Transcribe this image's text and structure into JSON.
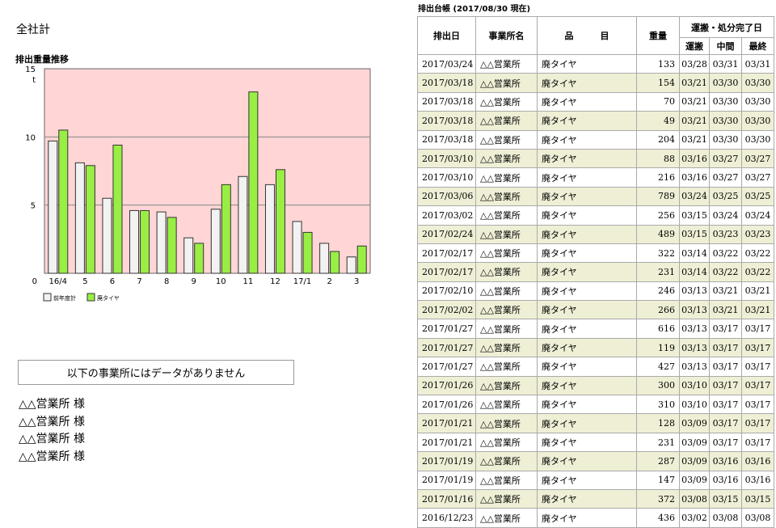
{
  "left": {
    "title": "全社計",
    "chart_title": "排出重量推移",
    "notice": "以下の事業所にはデータがありません",
    "offices": [
      "△△営業所 様",
      "△△営業所 様",
      "△△営業所 様",
      "△△営業所 様"
    ]
  },
  "chart_data": {
    "type": "bar",
    "title": "排出重量推移",
    "ylabel": "t",
    "ylim": [
      0,
      15
    ],
    "yticks": [
      0,
      5,
      10,
      15
    ],
    "categories": [
      "16/4",
      "5",
      "6",
      "7",
      "8",
      "9",
      "10",
      "11",
      "12",
      "17/1",
      "2",
      "3"
    ],
    "series": [
      {
        "name": "前年度計",
        "color": "#f2f2f2",
        "values": [
          9.7,
          8.1,
          5.5,
          4.6,
          4.5,
          2.6,
          4.7,
          7.1,
          6.5,
          3.8,
          2.2,
          1.2
        ]
      },
      {
        "name": "廃タイヤ",
        "color": "#99ee44",
        "values": [
          10.5,
          7.9,
          9.4,
          4.6,
          4.1,
          2.2,
          6.5,
          13.3,
          7.6,
          3.0,
          1.6,
          2.0
        ]
      }
    ],
    "plot_background": "#ffd5d5",
    "grid": true,
    "legend": "bottom-left"
  },
  "ledger": {
    "title": "排出台帳 (2017/08/30 現在)",
    "headers": {
      "date": "排出日",
      "office": "事業所名",
      "item": "品　　　目",
      "weight": "重量",
      "completion": "運搬・処分完了日",
      "transport": "運搬",
      "intermediate": "中間",
      "final": "最終"
    },
    "rows": [
      {
        "date": "2017/03/24",
        "office": "△△営業所",
        "item": "廃タイヤ",
        "weight": "133",
        "transport": "03/28",
        "intermediate": "03/31",
        "final": "03/31"
      },
      {
        "date": "2017/03/18",
        "office": "△△営業所",
        "item": "廃タイヤ",
        "weight": "154",
        "transport": "03/21",
        "intermediate": "03/30",
        "final": "03/30"
      },
      {
        "date": "2017/03/18",
        "office": "△△営業所",
        "item": "廃タイヤ",
        "weight": "70",
        "transport": "03/21",
        "intermediate": "03/30",
        "final": "03/30"
      },
      {
        "date": "2017/03/18",
        "office": "△△営業所",
        "item": "廃タイヤ",
        "weight": "49",
        "transport": "03/21",
        "intermediate": "03/30",
        "final": "03/30"
      },
      {
        "date": "2017/03/18",
        "office": "△△営業所",
        "item": "廃タイヤ",
        "weight": "204",
        "transport": "03/21",
        "intermediate": "03/30",
        "final": "03/30"
      },
      {
        "date": "2017/03/10",
        "office": "△△営業所",
        "item": "廃タイヤ",
        "weight": "88",
        "transport": "03/16",
        "intermediate": "03/27",
        "final": "03/27"
      },
      {
        "date": "2017/03/10",
        "office": "△△営業所",
        "item": "廃タイヤ",
        "weight": "216",
        "transport": "03/16",
        "intermediate": "03/27",
        "final": "03/27"
      },
      {
        "date": "2017/03/06",
        "office": "△△営業所",
        "item": "廃タイヤ",
        "weight": "789",
        "transport": "03/24",
        "intermediate": "03/25",
        "final": "03/25"
      },
      {
        "date": "2017/03/02",
        "office": "△△営業所",
        "item": "廃タイヤ",
        "weight": "256",
        "transport": "03/15",
        "intermediate": "03/24",
        "final": "03/24"
      },
      {
        "date": "2017/02/24",
        "office": "△△営業所",
        "item": "廃タイヤ",
        "weight": "489",
        "transport": "03/15",
        "intermediate": "03/23",
        "final": "03/23"
      },
      {
        "date": "2017/02/17",
        "office": "△△営業所",
        "item": "廃タイヤ",
        "weight": "322",
        "transport": "03/14",
        "intermediate": "03/22",
        "final": "03/22"
      },
      {
        "date": "2017/02/17",
        "office": "△△営業所",
        "item": "廃タイヤ",
        "weight": "231",
        "transport": "03/14",
        "intermediate": "03/22",
        "final": "03/22"
      },
      {
        "date": "2017/02/10",
        "office": "△△営業所",
        "item": "廃タイヤ",
        "weight": "246",
        "transport": "03/13",
        "intermediate": "03/21",
        "final": "03/21"
      },
      {
        "date": "2017/02/02",
        "office": "△△営業所",
        "item": "廃タイヤ",
        "weight": "266",
        "transport": "03/13",
        "intermediate": "03/21",
        "final": "03/21"
      },
      {
        "date": "2017/01/27",
        "office": "△△営業所",
        "item": "廃タイヤ",
        "weight": "616",
        "transport": "03/13",
        "intermediate": "03/17",
        "final": "03/17"
      },
      {
        "date": "2017/01/27",
        "office": "△△営業所",
        "item": "廃タイヤ",
        "weight": "119",
        "transport": "03/13",
        "intermediate": "03/17",
        "final": "03/17"
      },
      {
        "date": "2017/01/27",
        "office": "△△営業所",
        "item": "廃タイヤ",
        "weight": "427",
        "transport": "03/13",
        "intermediate": "03/17",
        "final": "03/17"
      },
      {
        "date": "2017/01/26",
        "office": "△△営業所",
        "item": "廃タイヤ",
        "weight": "300",
        "transport": "03/10",
        "intermediate": "03/17",
        "final": "03/17"
      },
      {
        "date": "2017/01/26",
        "office": "△△営業所",
        "item": "廃タイヤ",
        "weight": "310",
        "transport": "03/10",
        "intermediate": "03/17",
        "final": "03/17"
      },
      {
        "date": "2017/01/21",
        "office": "△△営業所",
        "item": "廃タイヤ",
        "weight": "128",
        "transport": "03/09",
        "intermediate": "03/17",
        "final": "03/17"
      },
      {
        "date": "2017/01/21",
        "office": "△△営業所",
        "item": "廃タイヤ",
        "weight": "231",
        "transport": "03/09",
        "intermediate": "03/17",
        "final": "03/17"
      },
      {
        "date": "2017/01/19",
        "office": "△△営業所",
        "item": "廃タイヤ",
        "weight": "287",
        "transport": "03/09",
        "intermediate": "03/16",
        "final": "03/16"
      },
      {
        "date": "2017/01/19",
        "office": "△△営業所",
        "item": "廃タイヤ",
        "weight": "147",
        "transport": "03/09",
        "intermediate": "03/16",
        "final": "03/16"
      },
      {
        "date": "2017/01/16",
        "office": "△△営業所",
        "item": "廃タイヤ",
        "weight": "372",
        "transport": "03/08",
        "intermediate": "03/15",
        "final": "03/15"
      },
      {
        "date": "2016/12/23",
        "office": "△△営業所",
        "item": "廃タイヤ",
        "weight": "436",
        "transport": "03/02",
        "intermediate": "03/08",
        "final": "03/08"
      }
    ]
  }
}
